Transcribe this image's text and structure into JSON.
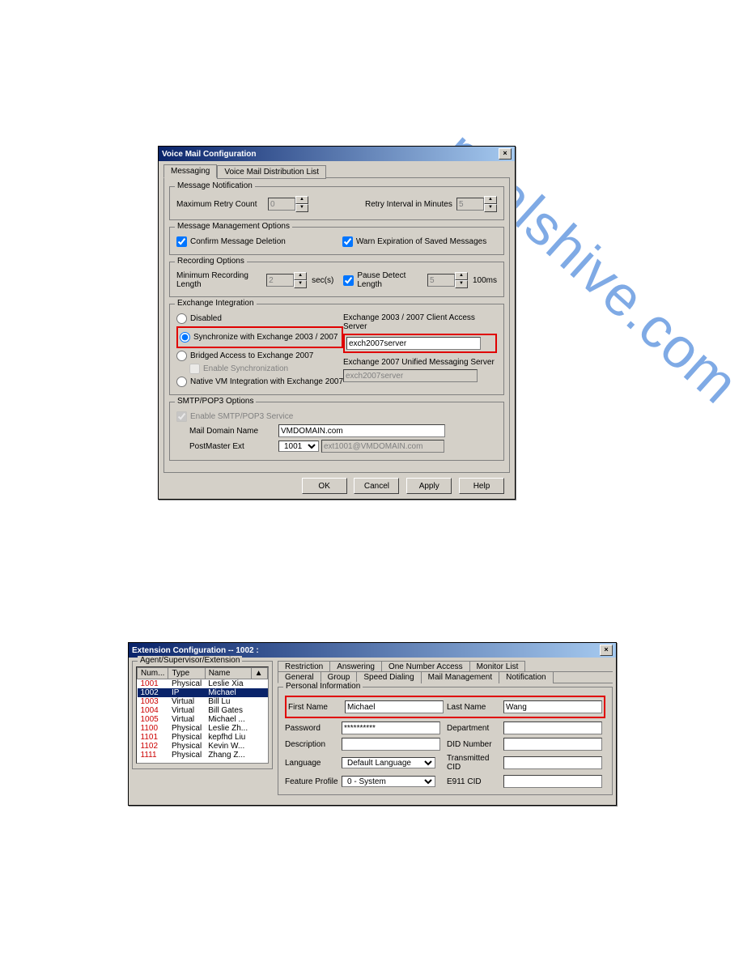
{
  "vm": {
    "title": "Voice Mail Configuration",
    "tabs": [
      "Messaging",
      "Voice Mail Distribution List"
    ],
    "notification": {
      "title": "Message Notification",
      "retry_label": "Maximum Retry Count",
      "retry_value": "0",
      "interval_label": "Retry Interval in Minutes",
      "interval_value": "5"
    },
    "management": {
      "title": "Message Management Options",
      "confirm": "Confirm Message Deletion",
      "warn": "Warn Expiration of Saved Messages"
    },
    "recording": {
      "title": "Recording Options",
      "minlen_label": "Minimum Recording Length",
      "minlen_value": "2",
      "secs": "sec(s)",
      "pause_label": "Pause Detect Length",
      "pause_value": "5",
      "ms": "100ms"
    },
    "exchange": {
      "title": "Exchange Integration",
      "disabled": "Disabled",
      "sync": "Synchronize with Exchange 2003 / 2007",
      "bridged": "Bridged Access to Exchange 2007",
      "enable_sync": "Enable Synchronization",
      "native": "Native VM Integration with Exchange 2007",
      "client_label": "Exchange 2003 / 2007 Client Access Server",
      "client_value": "exch2007server",
      "um_label": "Exchange 2007 Unified Messaging Server",
      "um_value": "exch2007server"
    },
    "smtp": {
      "title": "SMTP/POP3 Options",
      "enable": "Enable SMTP/POP3 Service",
      "domain_label": "Mail Domain Name",
      "domain_value": "VMDOMAIN.com",
      "pm_label": "PostMaster Ext",
      "pm_ext": "1001",
      "pm_email": "ext1001@VMDOMAIN.com"
    },
    "buttons": {
      "ok": "OK",
      "cancel": "Cancel",
      "apply": "Apply",
      "help": "Help"
    }
  },
  "ext": {
    "title": "Extension Configuration -- 1002 :",
    "left_title": "Agent/Supervisor/Extension",
    "cols": [
      "Num...",
      "Type",
      "Name"
    ],
    "rows": [
      {
        "num": "1001",
        "type": "Physical",
        "name": "Leslie Xia"
      },
      {
        "num": "1002",
        "type": "IP",
        "name": "Michael"
      },
      {
        "num": "1003",
        "type": "Virtual",
        "name": "Bill Lu"
      },
      {
        "num": "1004",
        "type": "Virtual",
        "name": "Bill Gates"
      },
      {
        "num": "1005",
        "type": "Virtual",
        "name": "Michael ..."
      },
      {
        "num": "1100",
        "type": "Physical",
        "name": "Leslie Zh..."
      },
      {
        "num": "1101",
        "type": "Physical",
        "name": "kepfhd Liu"
      },
      {
        "num": "1102",
        "type": "Physical",
        "name": "Kevin W..."
      },
      {
        "num": "1111",
        "type": "Physical",
        "name": "Zhang Z..."
      }
    ],
    "tabs_top": [
      "Restriction",
      "Answering",
      "One Number Access",
      "Monitor List"
    ],
    "tabs_bottom": [
      "General",
      "Group",
      "Speed Dialing",
      "Mail Management",
      "Notification"
    ],
    "personal": {
      "title": "Personal Information",
      "first_label": "First Name",
      "first": "Michael",
      "last_label": "Last Name",
      "last": "Wang",
      "pwd_label": "Password",
      "pwd": "**********",
      "dept_label": "Department",
      "dept": "",
      "desc_label": "Description",
      "desc": "",
      "did_label": "DID Number",
      "did": "",
      "lang_label": "Language",
      "lang": "Default Language",
      "cid_label": "Transmitted CID",
      "cid": "",
      "fp_label": "Feature Profile",
      "fp": "0 - System",
      "e911_label": "E911 CID",
      "e911": ""
    }
  }
}
